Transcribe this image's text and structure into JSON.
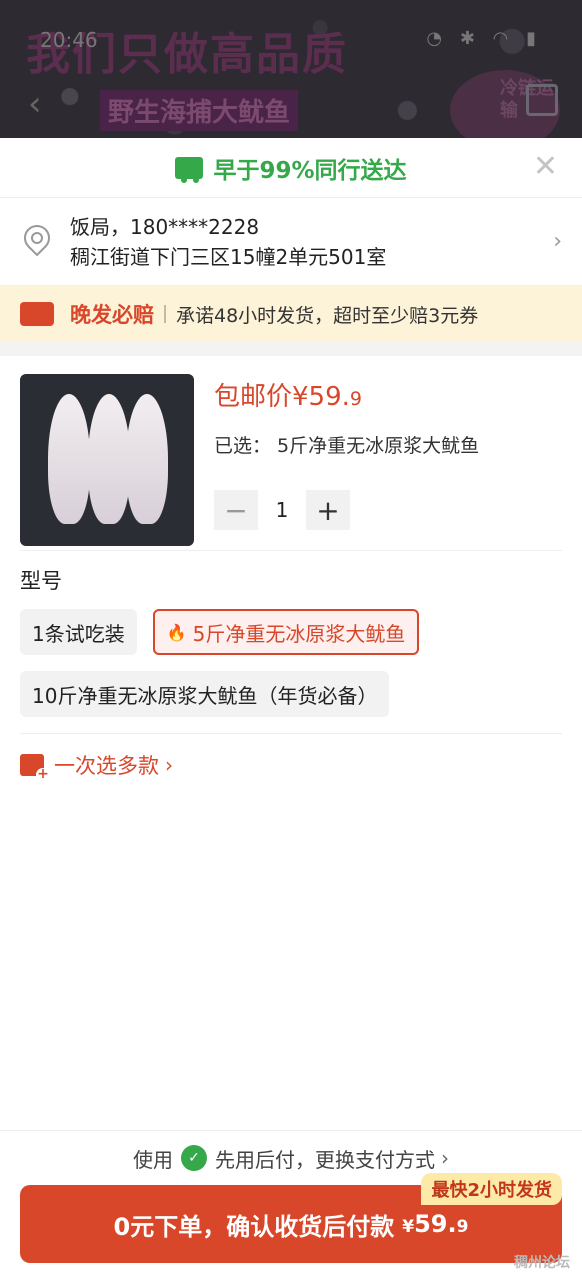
{
  "banner": {
    "headline": "我们只做高品质",
    "subline": "野生海捕大鱿鱼",
    "cold_badge": "冷链运输",
    "status_time": "20:46"
  },
  "delivery": {
    "text": "早于99%同行送达"
  },
  "address": {
    "line1": "饭局，180****2228",
    "line2": "稠江街道下门三区15幢2单元501室"
  },
  "promise": {
    "title": "晚发必赔",
    "text": "承诺48小时发货，超时至少赔3元券"
  },
  "product": {
    "price_label": "包邮价¥59.",
    "price_decimal": "9",
    "selected_label": "已选：  5斤净重无冰原浆大鱿鱼",
    "quantity": "1"
  },
  "spec": {
    "title": "型号",
    "options": [
      {
        "label": "1条试吃装"
      },
      {
        "label": "5斤净重无冰原浆大鱿鱼",
        "selected": true
      },
      {
        "label": "10斤净重无冰原浆大鱿鱼（年货必备）"
      }
    ]
  },
  "multi_select": {
    "label": "一次选多款"
  },
  "payment": {
    "prefix": "使用",
    "text": "先用后付，更换支付方式",
    "cta_label": "0元下单，确认收货后付款",
    "cta_yen": "¥",
    "cta_price": "59.",
    "cta_decimal": "9",
    "fast_tag": "最快2小时发货"
  },
  "watermark": "稠州论坛",
  "colors": {
    "accent_red": "#d9472b",
    "accent_green": "#35a94a",
    "promise_bg": "#fdf3d8"
  }
}
